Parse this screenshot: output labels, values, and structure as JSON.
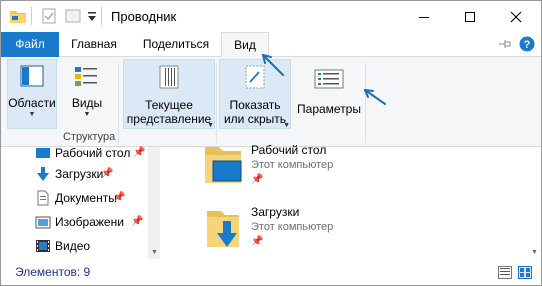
{
  "window": {
    "title": "Проводник"
  },
  "ribbon_tabs": [
    {
      "label": "Файл"
    },
    {
      "label": "Главная"
    },
    {
      "label": "Поделиться"
    },
    {
      "label": "Вид"
    }
  ],
  "ribbon": {
    "areas_label": "Области",
    "views_label": "Виды",
    "structure_group": "Структура",
    "current_view_line1": "Текущее",
    "current_view_line2": "представление",
    "show_hide_line1": "Показать",
    "show_hide_line2": "или скрыть",
    "options_label": "Параметры"
  },
  "nav": {
    "items": [
      {
        "label": "Рабочий стол",
        "pinned": true
      },
      {
        "label": "Загрузки",
        "pinned": true
      },
      {
        "label": "Документы",
        "pinned": true
      },
      {
        "label": "Изображени",
        "pinned": true
      },
      {
        "label": "Видео",
        "pinned": false
      }
    ]
  },
  "main": {
    "items": [
      {
        "name": "Рабочий стол",
        "sub": "Этот компьютер"
      },
      {
        "name": "Загрузки",
        "sub": "Этот компьютер"
      }
    ]
  },
  "status": {
    "count": "Элементов: 9"
  },
  "colors": {
    "accent": "#1979ca",
    "selection": "#dbe8f6",
    "arrow": "#1a6fb0"
  }
}
